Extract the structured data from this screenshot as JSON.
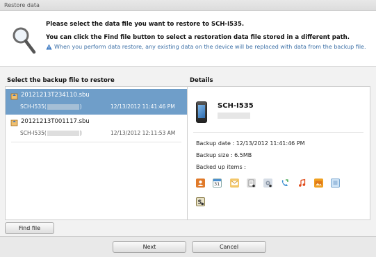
{
  "window": {
    "title": "Restore data"
  },
  "header": {
    "line1": "Please select the data file you want to restore to SCH-I535.",
    "line2": "You can click the Find file button to select a restoration data file stored in a different path.",
    "warning": "When you perform data restore, any existing data on the device will be replaced with data from the backup file."
  },
  "left": {
    "heading": "Select the backup file to restore",
    "files": [
      {
        "name": "20121213T234110.sbu",
        "device_prefix": "SCH-I535(",
        "device_suffix": ")",
        "date": "12/13/2012 11:41:46 PM",
        "selected": true
      },
      {
        "name": "20121213T001117.sbu",
        "device_prefix": "SCH-I535(",
        "device_suffix": ")",
        "date": "12/13/2012 12:11:53 AM",
        "selected": false
      }
    ]
  },
  "details": {
    "heading": "Details",
    "device_name": "SCH-I535",
    "backup_date": "Backup date : 12/13/2012 11:41:46 PM",
    "backup_size": "Backup size : 6.5MB",
    "backed_up_items": "Backed up items :",
    "item_icons": [
      "contacts-icon",
      "calendar-icon",
      "messages-icon",
      "memo-icon",
      "settings-icon",
      "call-log-icon",
      "music-icon",
      "photos-icon",
      "documents-icon",
      "apps-icon"
    ],
    "calendar_day": "31"
  },
  "buttons": {
    "find_file": "Find file",
    "next": "Next",
    "cancel": "Cancel"
  },
  "colors": {
    "selection": "#6f9ec9",
    "warning_text": "#3a6ea5"
  }
}
